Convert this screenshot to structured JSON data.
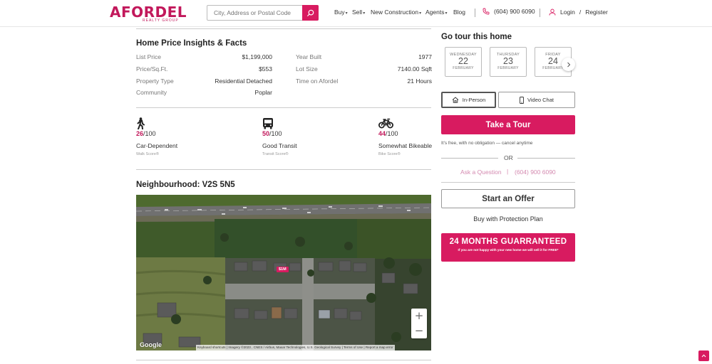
{
  "brand": {
    "logo_text": "AFORDEL",
    "logo_sub": "REALTY GROUP",
    "color": "#d81b60"
  },
  "header": {
    "search_placeholder": "City, Address or Postal Code",
    "nav": [
      {
        "label": "Buy"
      },
      {
        "label": "Sell"
      },
      {
        "label": "New Construction"
      },
      {
        "label": "Agents"
      },
      {
        "label": "Blog"
      }
    ],
    "phone": "(604) 900 6090",
    "login": "Login",
    "slash": "/",
    "register": "Register"
  },
  "facts": {
    "title": "Home Price Insights & Facts",
    "left": [
      {
        "label": "List Price",
        "value": "$1,199,000"
      },
      {
        "label": "Price/Sq.Ft.",
        "value": "$553"
      },
      {
        "label": "Property Type",
        "value": "Residential Detached"
      },
      {
        "label": "Community",
        "value": "Poplar"
      }
    ],
    "right": [
      {
        "label": "Year Built",
        "value": "1977"
      },
      {
        "label": "Lot Size",
        "value": "7140.00 Sqft"
      },
      {
        "label": "Time on Afordel",
        "value": "21 Hours"
      }
    ]
  },
  "scores": [
    {
      "icon": "walk-icon",
      "value": "26",
      "out_of": "/100",
      "desc": "Car-Dependent",
      "sub": "Walk Score®"
    },
    {
      "icon": "bus-icon",
      "value": "50",
      "out_of": "/100",
      "desc": "Good Transit",
      "sub": "Transit Score®"
    },
    {
      "icon": "bike-icon",
      "value": "44",
      "out_of": "/100",
      "desc": "Somewhat Bikeable",
      "sub": "Bike Score®"
    }
  ],
  "neighbourhood": {
    "title": "Neighbourhood: V2S 5N5",
    "map": {
      "price_pin": "$1M",
      "google": "Google",
      "attribution": "Keyboard shortcuts  |  Imagery ©2023 , CNES / Airbus, Maxar Technologies, U.S. Geological Survey  |  Terms of Use  |  Report a map error",
      "zoom_in": "+",
      "zoom_out": "−"
    }
  },
  "tour": {
    "title": "Go tour this home",
    "days": [
      {
        "weekday": "WEDNESDAY",
        "day": "22",
        "month": "FEBRUARY"
      },
      {
        "weekday": "THURSDAY",
        "day": "23",
        "month": "FEBRUARY"
      },
      {
        "weekday": "FRIDAY",
        "day": "24",
        "month": "FEBRUARY"
      }
    ],
    "in_person": "In-Person",
    "video_chat": "Video Chat",
    "button": "Take a Tour",
    "free_text": "It's free, with no obligation — cancel anytime",
    "or": "OR",
    "ask": "Ask a Question",
    "separator": "|",
    "phone": "(604) 900 6090",
    "offer": "Start an Offer",
    "protection": "Buy with Protection Plan",
    "guarantee_title": "24 MONTHS GUARRANTEED",
    "guarantee_sub": "If you are not happy with your new home we will sell it for FREE*"
  }
}
